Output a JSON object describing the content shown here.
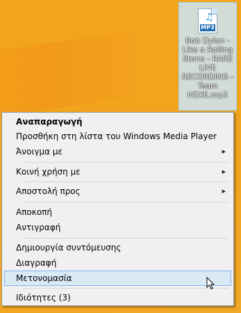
{
  "desktop": {
    "file": {
      "icon": "mp3-file-icon",
      "ext_badge": "MP3",
      "name": "Bob Dylan - Like a Rolling Stone - RARE LIVE RECORDING - Team HEXE.mp3"
    }
  },
  "context_menu": {
    "items": [
      {
        "label": "Αναπαραγωγή"
      },
      {
        "label": "Προσθήκη στη λίστα του Windows Media Player"
      },
      {
        "label": "Άνοιγμα με"
      },
      {
        "label": "Κοινή χρήση με"
      },
      {
        "label": "Αποστολή προς"
      },
      {
        "label": "Αποκοπή"
      },
      {
        "label": "Αντιγραφή"
      },
      {
        "label": "Δημιουργία συντόμευσης"
      },
      {
        "label": "Διαγραφή"
      },
      {
        "label": "Μετονομασία"
      },
      {
        "label": "Ιδιότητες (3)"
      }
    ],
    "submenu_arrow": "▶"
  }
}
